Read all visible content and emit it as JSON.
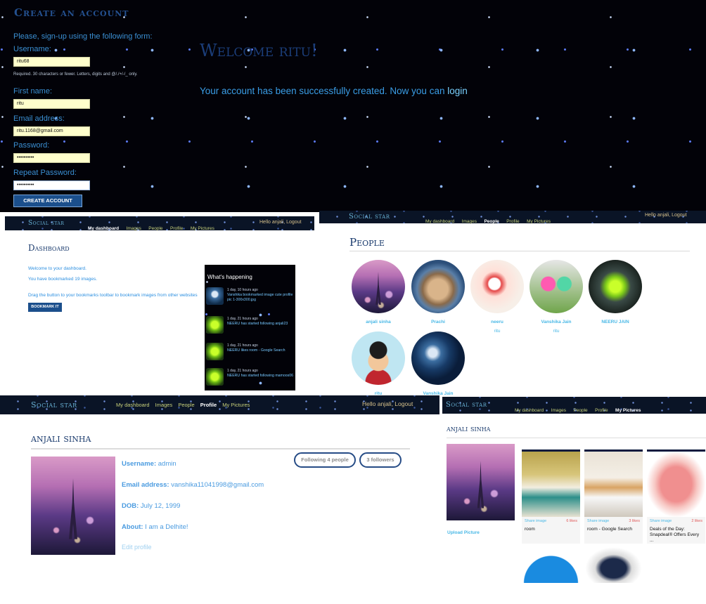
{
  "signup": {
    "title": "Create an account",
    "intro": "Please, sign-up using the following form:",
    "username_label": "Username:",
    "username_value": "ritu68",
    "username_help": "Required. 30 characters or fewer. Letters, digits and @/./+/-/_ only.",
    "first_name_label": "First name:",
    "first_name_value": "ritu",
    "email_label": "Email address:",
    "email_value": "ritu.1168@gmail.com",
    "password_label": "Password:",
    "password_value": "••••••••••",
    "repeat_label": "Repeat Password:",
    "repeat_value": "••••••••••",
    "button": "CREATE ACCOUNT"
  },
  "welcome": {
    "title": "Welcome ritu!",
    "message": "Your account has been successfully created. Now you can ",
    "login_link": "login"
  },
  "nav": {
    "brand": "Social star",
    "dashboard": "My dashboard",
    "images": "Images",
    "people": "People",
    "profile": "Profile",
    "pictures": "My Pictures",
    "hello": "Hello anjali, Logout"
  },
  "dashboard": {
    "title": "Dashboard",
    "welcome": "Welcome to your dashboard.",
    "bookmarked": "You have bookmarked 19 images.",
    "drag": "Drag the button to your bookmarks toolbar to bookmark images from other websites",
    "button": "BOOKMARK IT",
    "whats_happening": "What's happening",
    "events": [
      {
        "time": "1 day, 10 hours ago",
        "text": "Vanshika bookmarked image cute profile pic 1-300x300.jpg"
      },
      {
        "time": "1 day, 21 hours ago",
        "text": "NEERU has started following anjali23"
      },
      {
        "time": "1 day, 21 hours ago",
        "text": "NEERU likes room - Google Search"
      },
      {
        "time": "1 day, 21 hours ago",
        "text": "NEERU has started following mamoos06"
      }
    ]
  },
  "people": {
    "title": "People",
    "list": [
      {
        "name": "anjali sinha",
        "user": ""
      },
      {
        "name": "Prachi",
        "user": ""
      },
      {
        "name": "neeru",
        "user": "ritu"
      },
      {
        "name": "Vanshika Jain",
        "user": "ritu"
      },
      {
        "name": "NEERU JAIN",
        "user": ""
      },
      {
        "name": "ritu",
        "user": ""
      },
      {
        "name": "Vanshika Jain",
        "user": ""
      }
    ]
  },
  "profile": {
    "name": "anjali sinha",
    "username_label": "Username:",
    "username": "admin",
    "email_label": "Email address:",
    "email": "vanshika11041998@gmail.com",
    "dob_label": "DOB:",
    "dob": "July 12, 1999",
    "about_label": "About:",
    "about": "I am a Delhite!",
    "edit": "Edit profile",
    "following": "Following 4 people",
    "followers": "3 followers"
  },
  "pictures": {
    "name": "anjali sinha",
    "upload": "Upload Picture",
    "cards": [
      {
        "share": "Share image",
        "likes": "6 likes",
        "title": "room"
      },
      {
        "share": "Share image",
        "likes": "3 likes",
        "title": "room - Google Search"
      },
      {
        "share": "Share image",
        "likes": "2 likes",
        "title": "Deals of the Day: Snapdeal® Offers Every ..."
      }
    ]
  },
  "colors": {
    "navy": "#17386b",
    "accent": "#3a9de6",
    "input_bg": "#ffffcc"
  }
}
